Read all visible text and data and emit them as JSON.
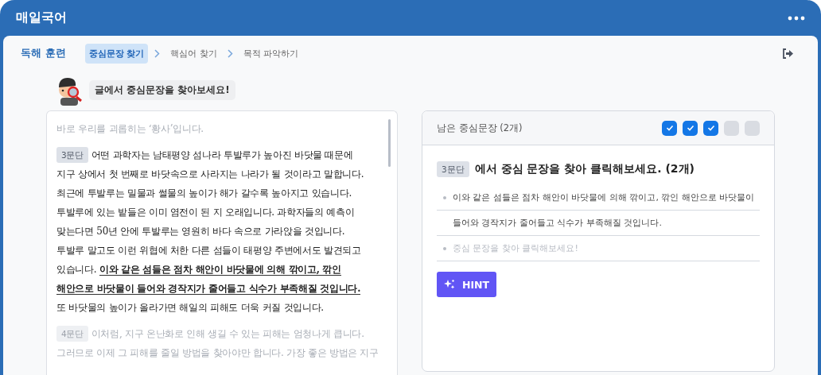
{
  "app_bar": {
    "logo": "매일국어"
  },
  "nav": {
    "title": "독해 훈련",
    "steps": [
      {
        "label": "중심문장 찾기",
        "selected": true
      },
      {
        "label": "핵심어 찾기",
        "selected": false
      },
      {
        "label": "목적 파악하기",
        "selected": false
      }
    ]
  },
  "guide": {
    "message": "글에서 중심문장을 찾아보세요!"
  },
  "passage": {
    "paragraphs": [
      {
        "faded": true,
        "lines": [
          [
            {
              "text": "바로 우리를 괴롭히는 ‘황사’입니다.",
              "kind": "plain"
            }
          ]
        ]
      },
      {
        "label": "3문단",
        "faded": false,
        "lines": [
          [
            {
              "text": "어떤 과학자는 남태평양 섬나라 투발루가 높아진 바닷물 때문에",
              "kind": "plain"
            }
          ],
          [
            {
              "text": "지구 상에서 첫 번째로 바닷속으로 사라지는 나라가 될 것이라고 말합니다.",
              "kind": "plain"
            }
          ],
          [
            {
              "text": "최근에 투발루는 밀물과 썰물의 높이가 해가 갈수록 높아지고 있습니다.",
              "kind": "plain"
            }
          ],
          [
            {
              "text": "투발루에 있는 밭들은 이미 염전이 된 지 오래입니다. 과학자들의 예측이",
              "kind": "plain"
            }
          ],
          [
            {
              "text": "맞는다면 50년 안에 투발루는 영원히 바다 속으로 가라앉을 것입니다.",
              "kind": "plain"
            }
          ],
          [
            {
              "text": "투발루 말고도 이런 위협에 처한 다른 섬들이 태평양 주변에서도 발견되고",
              "kind": "plain"
            }
          ],
          [
            {
              "text": "있습니다. ",
              "kind": "plain"
            },
            {
              "text": "이와 같은 섬들은 점차 해안이 바닷물에 의해 깎이고, 깎인",
              "kind": "key"
            }
          ],
          [
            {
              "text": "해안으로 바닷물이 들어와 경작지가 줄어들고 식수가 부족해질 것입니다.",
              "kind": "key"
            }
          ],
          [
            {
              "text": "또 바닷물의 높이가 올라가면 해일의 피해도 더욱 커질 것입니다.",
              "kind": "plain"
            }
          ]
        ]
      },
      {
        "label": "4문단",
        "faded": true,
        "lines": [
          [
            {
              "text": "이처럼, 지구 온난화로 인해 생길 수 있는 피해는 엄청나게 큽니다.",
              "kind": "plain"
            }
          ],
          [
            {
              "text": "그러므로 이제 그 피해를 줄일 방법을 찾아야만 합니다. 가장 좋은 방법은 지구",
              "kind": "plain"
            }
          ]
        ]
      }
    ]
  },
  "answer_panel": {
    "title": "남은 중심문장 (2개)",
    "progress": [
      {
        "checked": true
      },
      {
        "checked": true
      },
      {
        "checked": true
      },
      {
        "checked": false
      },
      {
        "checked": false
      }
    ],
    "prompt_label": "3문단",
    "prompt": "에서 중심 문장을 찾아 클릭해보세요. (2개)",
    "answers": [
      {
        "kind": "found",
        "lines": [
          "이와 같은 섬들은 점차 해안이 바닷물에 의해 깎이고, 깎인 해안으로 바닷물이",
          "들어와 경작지가 줄어들고 식수가 부족해질 것입니다."
        ]
      },
      {
        "kind": "empty",
        "lines": [
          "중심 문장을 찾아 클릭해보세요!"
        ]
      }
    ],
    "hint_button": "HINT"
  }
}
